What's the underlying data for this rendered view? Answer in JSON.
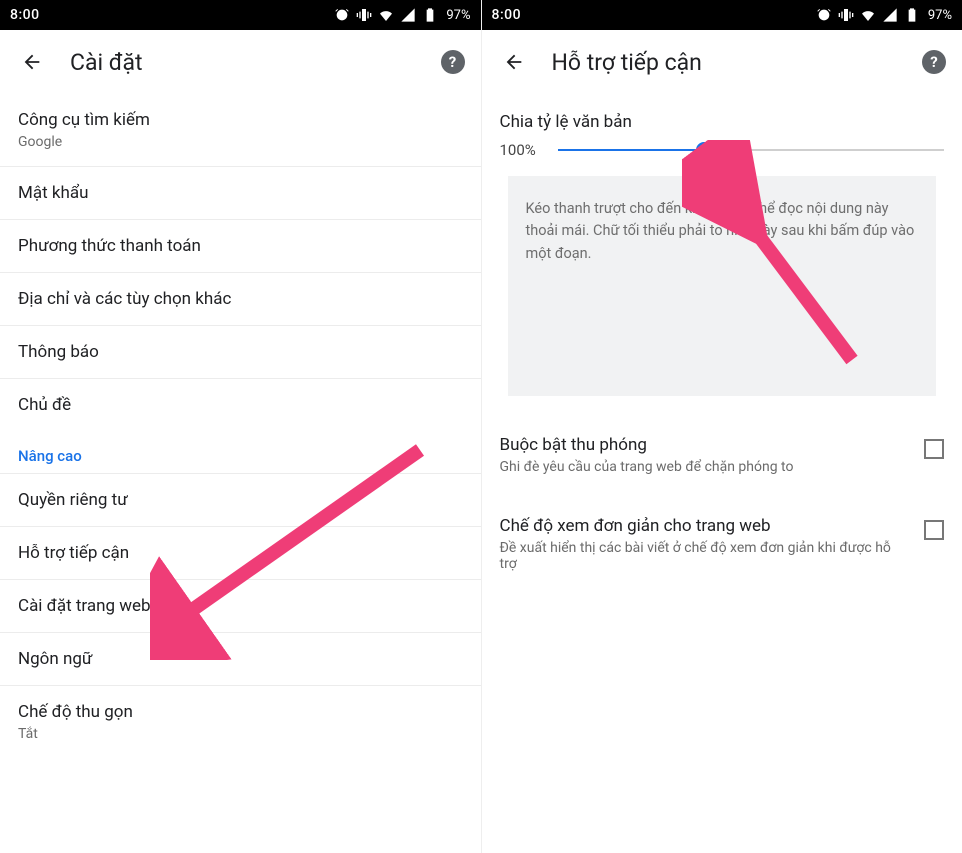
{
  "statusbar": {
    "time": "8:00",
    "battery_pct": "97%"
  },
  "left": {
    "header": {
      "title": "Cài đặt"
    },
    "items": [
      {
        "title": "Công cụ tìm kiếm",
        "sub": "Google"
      },
      {
        "title": "Mật khẩu"
      },
      {
        "title": "Phương thức thanh toán"
      },
      {
        "title": "Địa chỉ và các tùy chọn khác"
      },
      {
        "title": "Thông báo"
      },
      {
        "title": "Chủ đề"
      }
    ],
    "section_advanced": "Nâng cao",
    "items2": [
      {
        "title": "Quyền riêng tư"
      },
      {
        "title": "Hỗ trợ tiếp cận"
      },
      {
        "title": "Cài đặt trang web"
      },
      {
        "title": "Ngôn ngữ"
      },
      {
        "title": "Chế độ thu gọn",
        "sub": "Tắt"
      }
    ]
  },
  "right": {
    "header": {
      "title": "Hỗ trợ tiếp cận"
    },
    "text_scaling": {
      "label": "Chia tỷ lệ văn bản",
      "value": "100%",
      "slider_pct": 38
    },
    "example_text": "Kéo thanh trượt cho đến khi bạn có thể đọc nội dung này thoải mái. Chữ tối thiểu phải to như này sau khi bấm đúp vào một đoạn.",
    "options": [
      {
        "title": "Buộc bật thu phóng",
        "sub": "Ghi đè yêu cầu của trang web để chặn phóng to"
      },
      {
        "title": "Chế độ xem đơn giản cho trang web",
        "sub": "Đề xuất hiển thị các bài viết ở chế độ xem đơn giản khi được hỗ trợ"
      }
    ]
  }
}
